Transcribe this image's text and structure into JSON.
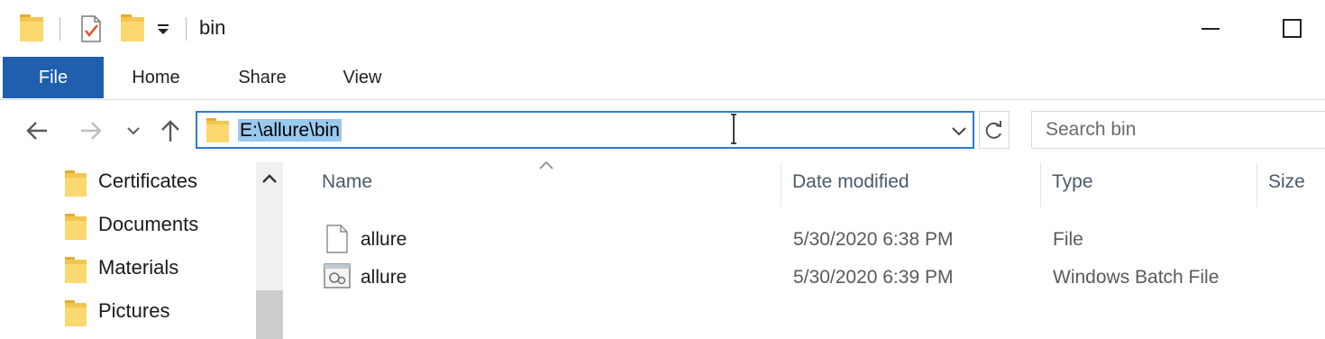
{
  "window": {
    "title": "bin"
  },
  "ribbon": {
    "tabs": [
      {
        "label": "File"
      },
      {
        "label": "Home"
      },
      {
        "label": "Share"
      },
      {
        "label": "View"
      }
    ]
  },
  "address": {
    "path": "E:\\allure\\bin"
  },
  "search": {
    "placeholder": "Search bin"
  },
  "nav_pane": {
    "items": [
      {
        "label": "Certificates"
      },
      {
        "label": "Documents"
      },
      {
        "label": "Materials"
      },
      {
        "label": "Pictures"
      }
    ]
  },
  "file_list": {
    "columns": [
      {
        "label": "Name"
      },
      {
        "label": "Date modified"
      },
      {
        "label": "Type"
      },
      {
        "label": "Size"
      }
    ],
    "rows": [
      {
        "name": "allure",
        "date": "5/30/2020 6:38 PM",
        "type": "File",
        "icon": "file-icon"
      },
      {
        "name": "allure",
        "date": "5/30/2020 6:39 PM",
        "type": "Windows Batch File",
        "icon": "batch-file-icon"
      }
    ]
  },
  "colors": {
    "file_tab": "#1f5fae",
    "address_border": "#2b79d6",
    "selection": "#99c9ef",
    "folder": "#f3c650"
  }
}
